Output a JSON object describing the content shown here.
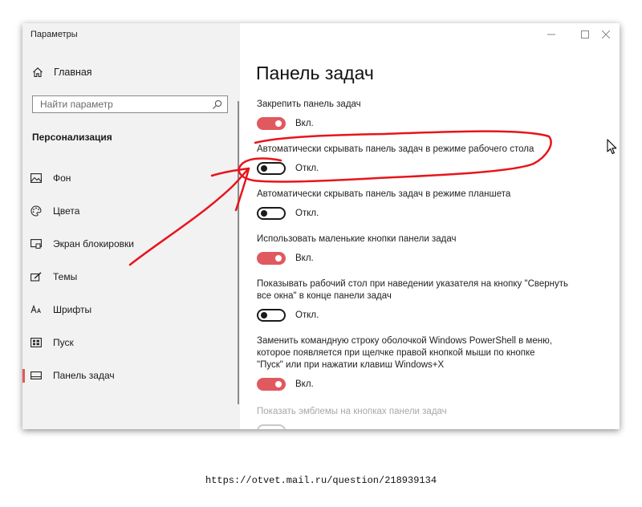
{
  "window": {
    "title": "Параметры"
  },
  "sidebar": {
    "home_label": "Главная",
    "search_placeholder": "Найти параметр",
    "section_title": "Персонализация",
    "items": [
      {
        "label": "Фон",
        "icon": "image-icon"
      },
      {
        "label": "Цвета",
        "icon": "palette-icon"
      },
      {
        "label": "Экран блокировки",
        "icon": "lock-screen-icon"
      },
      {
        "label": "Темы",
        "icon": "themes-icon"
      },
      {
        "label": "Шрифты",
        "icon": "fonts-icon"
      },
      {
        "label": "Пуск",
        "icon": "start-icon"
      },
      {
        "label": "Панель задач",
        "icon": "taskbar-icon",
        "active": true
      }
    ]
  },
  "main": {
    "title": "Панель задач",
    "settings": [
      {
        "label": "Закрепить панель задач",
        "state": "on",
        "state_label": "Вкл."
      },
      {
        "label": "Автоматически скрывать панель задач в режиме рабочего стола",
        "state": "off",
        "state_label": "Откл."
      },
      {
        "label": "Автоматически скрывать панель задач в режиме планшета",
        "state": "off",
        "state_label": "Откл."
      },
      {
        "label": "Использовать маленькие кнопки панели задач",
        "state": "on",
        "state_label": "Вкл."
      },
      {
        "label": "Показывать рабочий стол при наведении указателя на кнопку \"Свернуть все окна\" в конце панели задач",
        "state": "off",
        "state_label": "Откл."
      },
      {
        "label": "Заменить командную строку оболочкой Windows PowerShell в меню, которое появляется при щелчке правой кнопкой мыши по кнопке \"Пуск\" или при нажатии клавиш Windows+X",
        "state": "on",
        "state_label": "Вкл."
      },
      {
        "label": "Показать эмблемы на кнопках панели задач",
        "state": "disabled"
      }
    ]
  },
  "footer": {
    "url": "https://otvet.mail.ru/question/218939134"
  },
  "colors": {
    "accent": "#e0595f",
    "annotation": "#e8141c",
    "sidebar_bg": "#f2f2f2"
  }
}
